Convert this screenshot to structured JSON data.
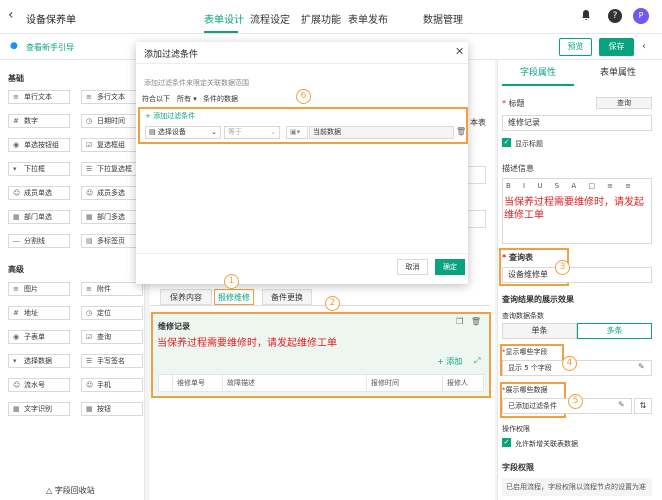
{
  "app": {
    "title": "设备保养单"
  },
  "nav": [
    "表单设计",
    "流程设定",
    "扩展功能",
    "表单发布",
    "数据管理"
  ],
  "help_glyph": "?",
  "avatar": "P",
  "guide": "查看新手引导",
  "actions": {
    "preview": "预览",
    "save": "保存"
  },
  "left": {
    "section_basic": "基础",
    "basic": [
      "单行文本",
      "多行文本",
      "数字",
      "日期时间",
      "单选按钮组",
      "复选框组",
      "下拉框",
      "下拉复选框",
      "成员单选",
      "成员多选",
      "部门单选",
      "部门多选",
      "分割线",
      "多标签页"
    ],
    "section_adv": "高级",
    "advanced": [
      "图片",
      "附件",
      "地址",
      "定位",
      "子表单",
      "查询",
      "选择数据",
      "手写签名",
      "流水号",
      "手机",
      "文字识别",
      "按钮"
    ],
    "recycle": "字段回收站"
  },
  "canvas": {
    "tabs": [
      "保养内容",
      "报修维修",
      "备件更换"
    ],
    "subform_title": "维修记录",
    "subform_desc": "当保养过程需要维修时，请发起维修工单",
    "add": "添加",
    "columns": [
      "维修单号",
      "故障描述",
      "报修时间",
      "报修人"
    ],
    "partial_text": "本表"
  },
  "modal": {
    "title": "添加过滤条件",
    "hint": "添加过滤条件来限定关联数据范围",
    "match_prefix": "符合以下",
    "match_value": "所有",
    "match_suffix": "条件的数据",
    "add_condition": "+ 添加过滤条件",
    "field": "选择设备",
    "operator": "等于",
    "value": "当前数据",
    "cancel": "取消",
    "ok": "确定"
  },
  "right": {
    "tabs": [
      "字段属性",
      "表单属性"
    ],
    "title_label": "标题",
    "title_btn": "查询",
    "title_value": "维修记录",
    "show_title": "显示标题",
    "desc_label": "描述信息",
    "desc_text": "当保养过程需要维修时，请发起维修工单",
    "query_table_label": "查询表",
    "query_table_value": "设备维修单",
    "result_label": "查询结果的展示效果",
    "count_label": "查询数据条数",
    "single": "单条",
    "multi": "多条",
    "fields_label": "显示哪些字段",
    "fields_value": "显示 5 个字段",
    "data_label": "展示哪些数据",
    "data_value": "已添加过滤条件",
    "perm_label": "操作权限",
    "allow_new": "允许新增关联表数据",
    "field_perm_label": "字段权限",
    "field_perm_note": "已启用流程，字段权限以流程节点的设置为准"
  },
  "badges": [
    "1",
    "2",
    "3",
    "4",
    "5",
    "6"
  ],
  "colors": {
    "accent": "#0aa37f",
    "highlight": "#f0a040",
    "red_text": "#e02020"
  }
}
